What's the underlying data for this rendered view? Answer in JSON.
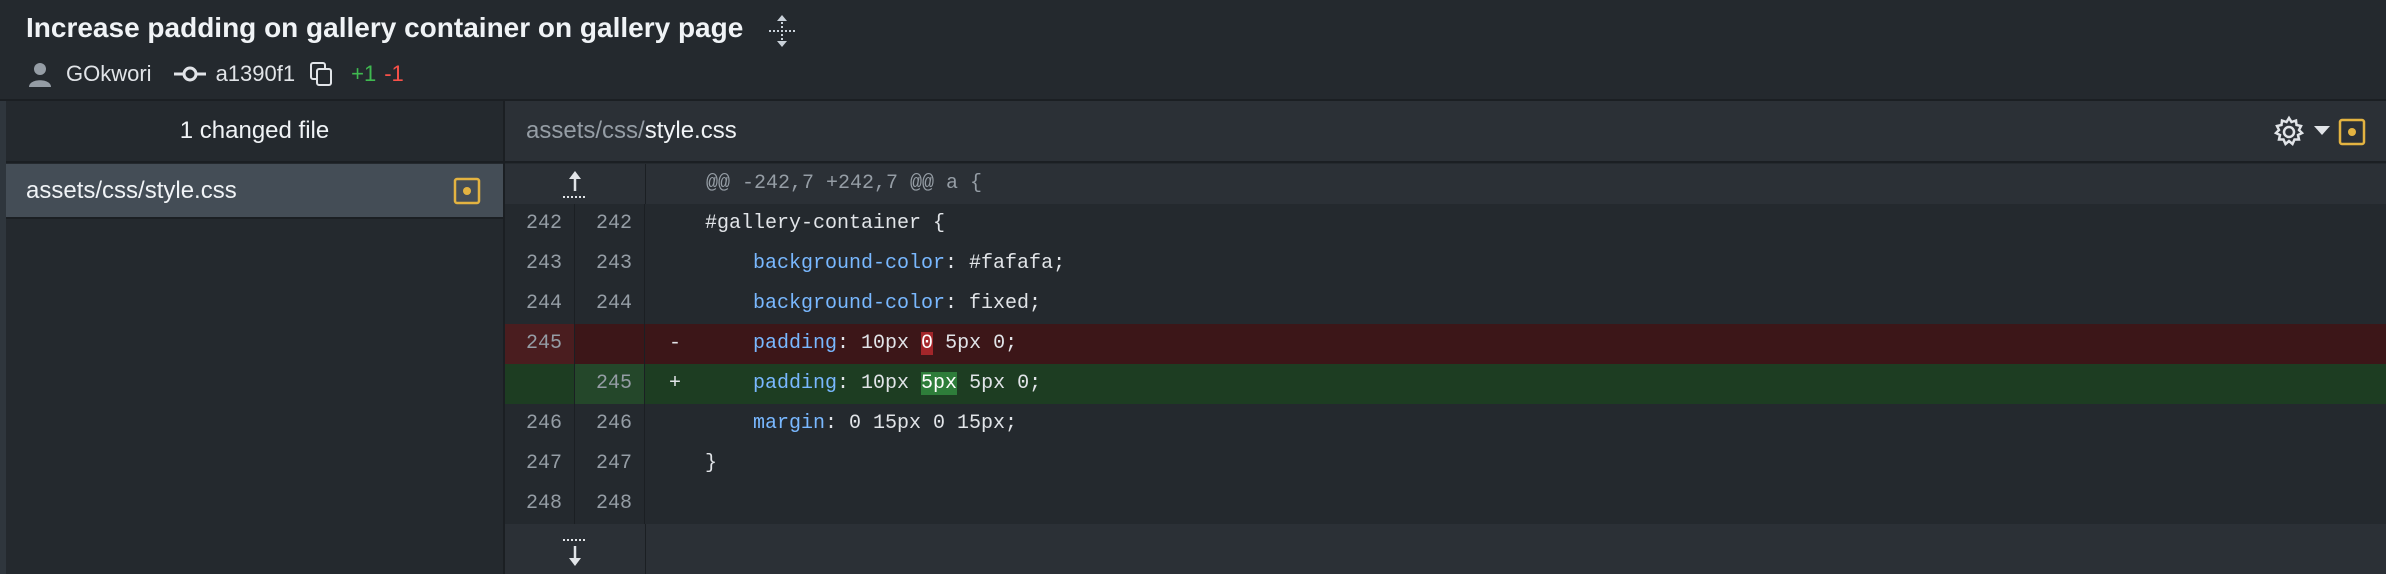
{
  "commit": {
    "title": "Increase padding on gallery container on gallery page",
    "author": "GOkwori",
    "sha": "a1390f1",
    "additions": "+1",
    "deletions": "-1"
  },
  "sidebar": {
    "header": "1 changed file",
    "files": [
      {
        "path": "assets/css/style.css"
      }
    ]
  },
  "diff": {
    "file_dir": "assets/css/",
    "file_name": "style.css",
    "hunk_header": "@@ -242,7 +242,7 @@ a {",
    "lines": [
      {
        "type": "ctx",
        "old": "242",
        "new": "242",
        "marker": "",
        "code": "#gallery-container {"
      },
      {
        "type": "ctx",
        "old": "243",
        "new": "243",
        "marker": "",
        "prop": "background-color",
        "rest": ": #fafafa;"
      },
      {
        "type": "ctx",
        "old": "244",
        "new": "244",
        "marker": "",
        "prop": "background-color",
        "rest": ": fixed;"
      },
      {
        "type": "del",
        "old": "245",
        "new": "",
        "marker": "-",
        "prop": "padding",
        "pre": ": 10px ",
        "hl": "0",
        "post": " 5px 0;"
      },
      {
        "type": "add",
        "old": "",
        "new": "245",
        "marker": "+",
        "prop": "padding",
        "pre": ": 10px ",
        "hl": "5px",
        "post": " 5px 0;"
      },
      {
        "type": "ctx",
        "old": "246",
        "new": "246",
        "marker": "",
        "prop": "margin",
        "rest": ": 0 15px 0 15px;"
      },
      {
        "type": "ctx",
        "old": "247",
        "new": "247",
        "marker": "",
        "code": "}"
      },
      {
        "type": "ctx",
        "old": "248",
        "new": "248",
        "marker": "",
        "code": ""
      }
    ]
  },
  "colors": {
    "added": "#3fb950",
    "removed": "#f85149",
    "modified_icon": "#e3b341"
  }
}
